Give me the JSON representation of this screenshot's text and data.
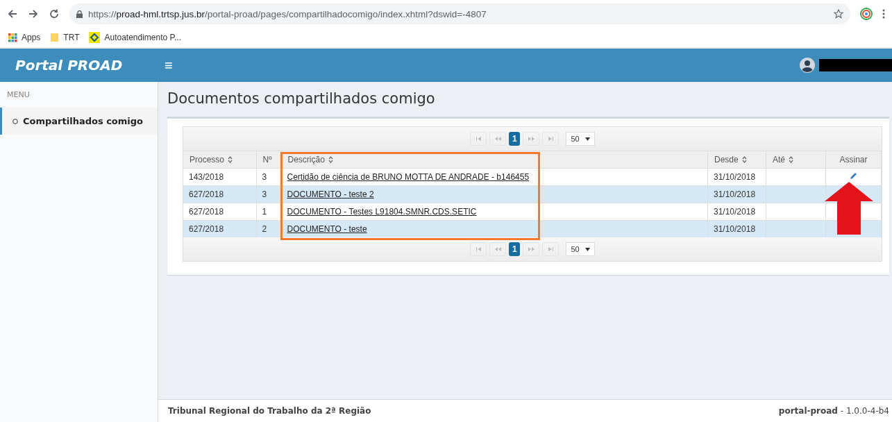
{
  "browser": {
    "url": {
      "scheme": "https://",
      "host": "proad-hml.trtsp.jus.br",
      "path": "/portal-proad/pages/compartilhadocomigo/index.xhtml?dswid=-4807"
    },
    "bookmarks": [
      {
        "kind": "apps",
        "label": "Apps"
      },
      {
        "kind": "folder",
        "label": "TRT"
      },
      {
        "kind": "site",
        "label": "Autoatendimento P..."
      }
    ]
  },
  "header": {
    "brand": "Portal PROAD",
    "menu_glyph": "≡"
  },
  "sidebar": {
    "heading": "MENU",
    "items": [
      {
        "label": "Compartilhados comigo",
        "selected": true
      }
    ]
  },
  "page": {
    "title": "Documentos compartilhados comigo"
  },
  "table": {
    "paginator_top": {
      "buttons": [
        {
          "kind": "first",
          "selected": false
        },
        {
          "kind": "previous",
          "selected": false
        },
        {
          "kind": "page",
          "label": "1",
          "selected": true
        },
        {
          "kind": "next",
          "selected": false
        },
        {
          "kind": "last",
          "selected": false
        }
      ],
      "rows_per_page": "50"
    },
    "paginator_bottom": {
      "buttons": [
        {
          "kind": "first",
          "selected": false
        },
        {
          "kind": "previous",
          "selected": false
        },
        {
          "kind": "page",
          "label": "1",
          "selected": true
        },
        {
          "kind": "next",
          "selected": false
        },
        {
          "kind": "last",
          "selected": false
        }
      ],
      "rows_per_page": "50"
    },
    "columns": [
      {
        "label": "Processo",
        "sortable": true
      },
      {
        "label": "Nº",
        "sortable": false
      },
      {
        "label": "Descrição",
        "sortable": true
      },
      {
        "label": "Desde",
        "sortable": true
      },
      {
        "label": "Até",
        "sortable": true
      },
      {
        "label": "Assinar",
        "sortable": false
      }
    ],
    "rows": [
      {
        "processo": "143/2018",
        "numero": "3",
        "descricao": "Certidão de ciência de BRUNO MOTTA DE ANDRADE - b146455",
        "desde": "31/10/2018",
        "signable": true
      },
      {
        "processo": "627/2018",
        "numero": "3",
        "descricao": "DOCUMENTO - teste 2",
        "desde": "31/10/2018"
      },
      {
        "processo": "627/2018",
        "numero": "1",
        "descricao": "DOCUMENTO - Testes L91804.SMNR.CDS.SETIC",
        "desde": "31/10/2018"
      },
      {
        "processo": "627/2018",
        "numero": "2",
        "descricao": "DOCUMENTO - teste",
        "desde": "31/10/2018"
      }
    ]
  },
  "footer": {
    "left": "Tribunal Regional do Trabalho da 2ª Região",
    "right": "**portal-proad** - 1.0.0-4-b4"
  }
}
